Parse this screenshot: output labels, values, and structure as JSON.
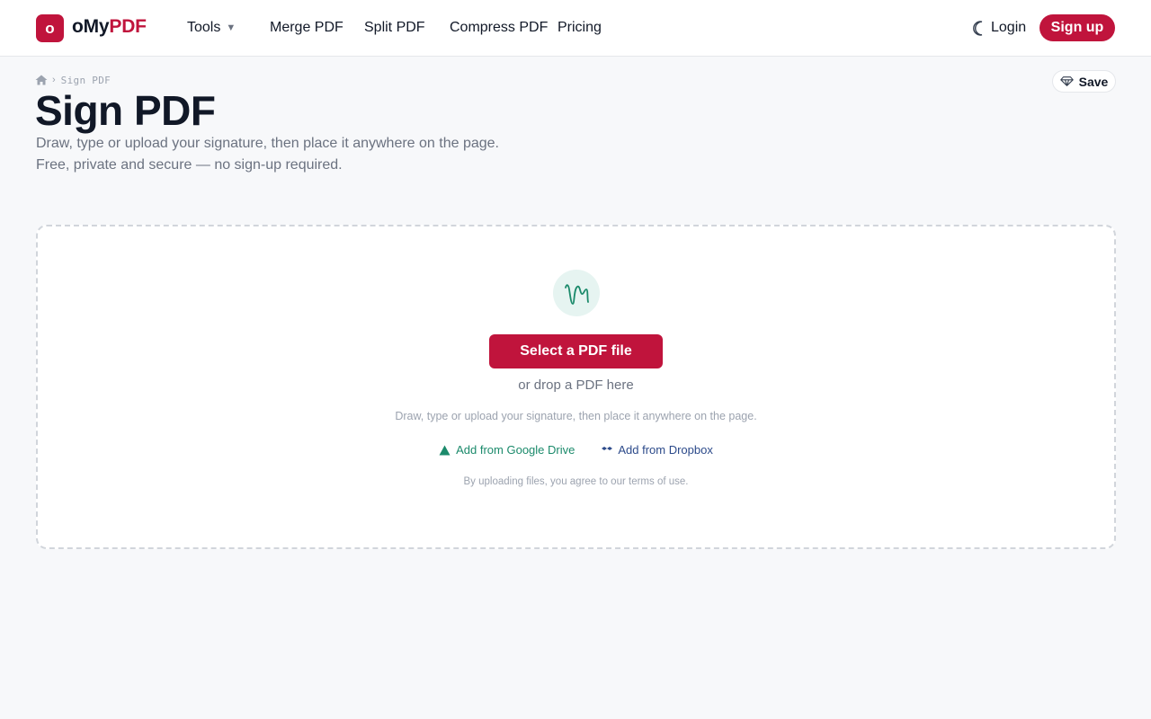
{
  "brand": {
    "logo_letter": "o",
    "name_prefix": "oMy",
    "name_suffix": "PDF",
    "accent": "#c0143c"
  },
  "nav": {
    "tools": "Tools",
    "merge": "Merge PDF",
    "split": "Split PDF",
    "compress": "Compress PDF",
    "pricing": "Pricing"
  },
  "header": {
    "login": "Login",
    "signup": "Sign up",
    "theme_icon": "moon-icon"
  },
  "breadcrumb": {
    "home_icon": "home-icon",
    "current": "Sign PDF"
  },
  "page": {
    "title": "Sign PDF",
    "subtitle_line1": "Draw, type or upload your signature, then place it anywhere on the page.",
    "subtitle_line2": "Free, private and secure — no sign-up required.",
    "save_label": "Save"
  },
  "dropzone": {
    "icon": "signature-icon",
    "select_button": "Select a PDF file",
    "drop_hint": "or drop a PDF here",
    "description": "Draw, type or upload your signature, then place it anywhere on the page.",
    "google_drive": "Add from Google Drive",
    "dropbox": "Add from Dropbox",
    "terms": "By uploading files, you agree to our terms of use."
  },
  "colors": {
    "brand_red": "#c0143c",
    "drive_green": "#1b8a6b",
    "dropbox_blue": "#2c4a8a"
  }
}
